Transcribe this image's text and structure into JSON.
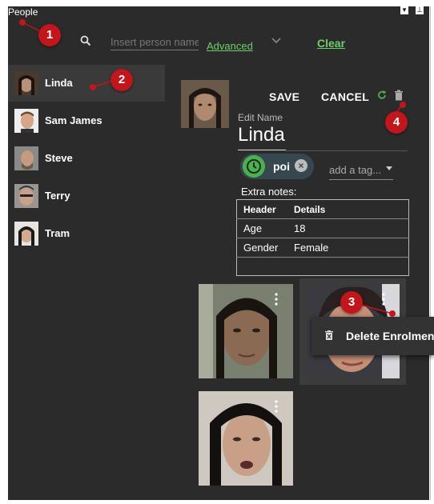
{
  "window": {
    "title": "People"
  },
  "toolbar": {
    "search_placeholder": "Insert person name",
    "advanced_label": "Advanced",
    "clear_label": "Clear"
  },
  "people": [
    {
      "name": "Linda",
      "selected": true
    },
    {
      "name": "Sam James",
      "selected": false
    },
    {
      "name": "Steve",
      "selected": false
    },
    {
      "name": "Terry",
      "selected": false
    },
    {
      "name": "Tram",
      "selected": false
    }
  ],
  "editor": {
    "save_label": "SAVE",
    "cancel_label": "CANCEL",
    "edit_name_label": "Edit Name",
    "name": "Linda",
    "tag": "poi",
    "add_tag_placeholder": "add a tag...",
    "extra_notes_label": "Extra notes:",
    "table": {
      "headers": [
        "Header",
        "Details"
      ],
      "rows": [
        [
          "Age",
          "18"
        ],
        [
          "Gender",
          "Female"
        ]
      ]
    }
  },
  "enrolments": {
    "context_menu": {
      "delete_label": "Delete Enrolment"
    }
  },
  "annotations": [
    "1",
    "2",
    "3",
    "4"
  ],
  "colors": {
    "accent_green": "#6ecf6a",
    "badge_red": "#c0161c",
    "background": "#2b2b2b"
  },
  "icons": [
    "search-icon",
    "chevron-down-icon",
    "refresh-icon",
    "trash-icon",
    "clock-icon",
    "close-icon",
    "dropdown-arrow-icon",
    "more-vert-icon",
    "delete-icon"
  ]
}
